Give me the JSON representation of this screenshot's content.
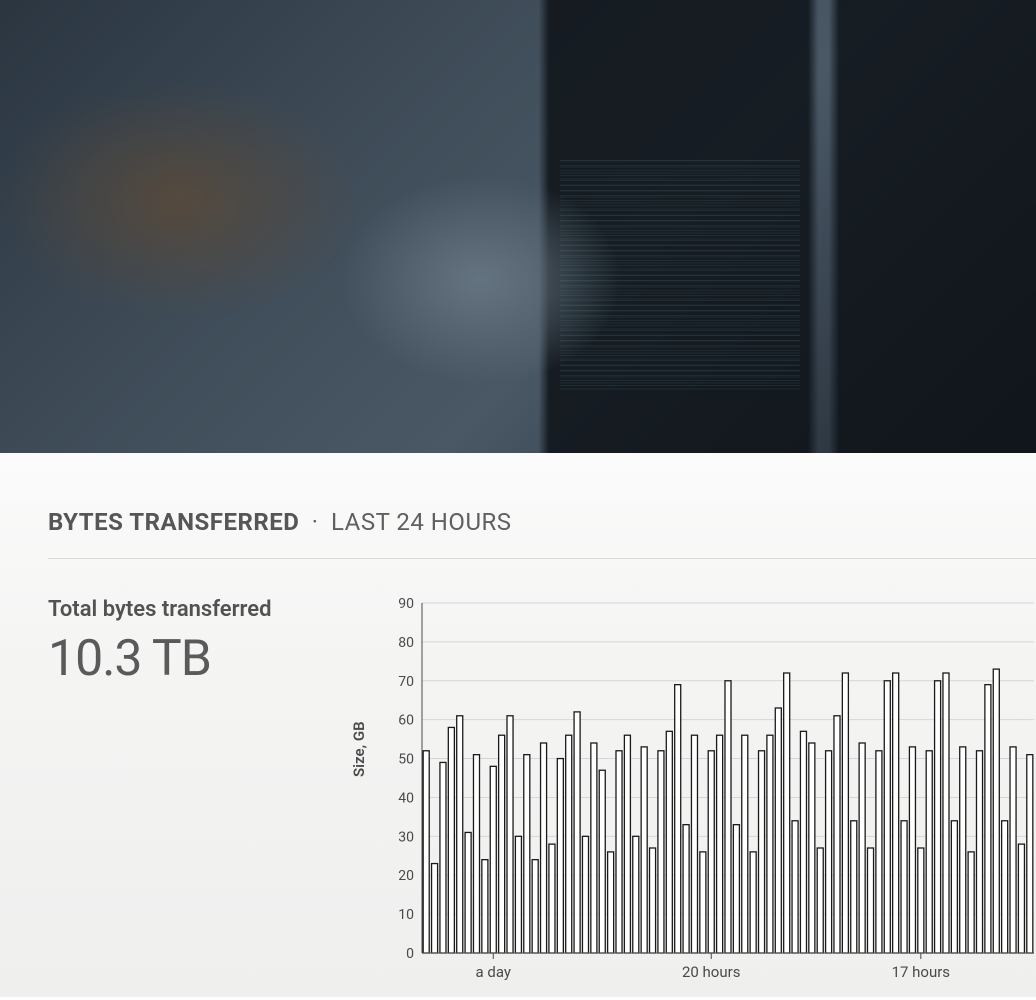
{
  "hero": {
    "alt": "developers-at-monitors"
  },
  "panel": {
    "title_bold": "BYTES TRANSFERRED",
    "title_sep": "·",
    "title_rest": "LAST 24 HOURS",
    "summary_label": "Total bytes transferred",
    "summary_value": "10.3 TB"
  },
  "chart_data": {
    "type": "bar",
    "title": "",
    "xlabel": "",
    "ylabel": "Size, GB",
    "ylim": [
      0,
      90
    ],
    "y_ticks": [
      0,
      10,
      20,
      30,
      40,
      50,
      60,
      70,
      80,
      90
    ],
    "x_tick_labels": [
      "a day",
      "20 hours",
      "17 hours"
    ],
    "x_tick_positions": [
      8,
      34,
      59
    ],
    "values": [
      52,
      23,
      49,
      58,
      61,
      31,
      51,
      24,
      48,
      56,
      61,
      30,
      51,
      24,
      54,
      28,
      50,
      56,
      62,
      30,
      54,
      47,
      26,
      52,
      56,
      30,
      53,
      27,
      52,
      57,
      69,
      33,
      56,
      26,
      52,
      56,
      70,
      33,
      56,
      26,
      52,
      56,
      63,
      72,
      34,
      57,
      54,
      27,
      52,
      61,
      72,
      34,
      54,
      27,
      52,
      70,
      72,
      34,
      53,
      27,
      52,
      70,
      72,
      34,
      53,
      26,
      52,
      69,
      73,
      34,
      53,
      28,
      51
    ]
  }
}
